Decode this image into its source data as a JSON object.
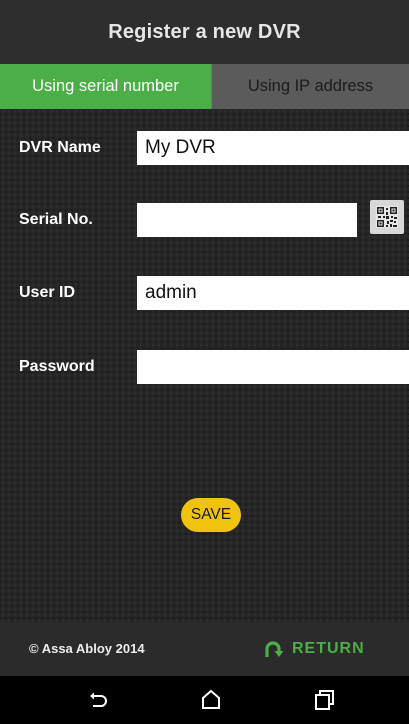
{
  "header": {
    "title": "Register a new DVR"
  },
  "tabs": [
    {
      "label": "Using serial number",
      "active": true
    },
    {
      "label": "Using IP address",
      "active": false
    }
  ],
  "form": {
    "dvr_name": {
      "label": "DVR Name",
      "value": "My DVR"
    },
    "serial_no": {
      "label": "Serial No.",
      "value": ""
    },
    "user_id": {
      "label": "User ID",
      "value": "admin"
    },
    "password": {
      "label": "Password",
      "value": ""
    }
  },
  "save_label": "SAVE",
  "footer": {
    "copyright": "© Assa Abloy 2014",
    "return_label": "RETURN"
  },
  "colors": {
    "accent_green": "#4cae47",
    "save_yellow": "#f0c30f",
    "background": "#262626"
  },
  "icons": {
    "qr": "qr-code-icon",
    "return": "return-arrow-icon",
    "nav_back": "back-icon",
    "nav_home": "home-icon",
    "nav_recents": "recents-icon"
  }
}
